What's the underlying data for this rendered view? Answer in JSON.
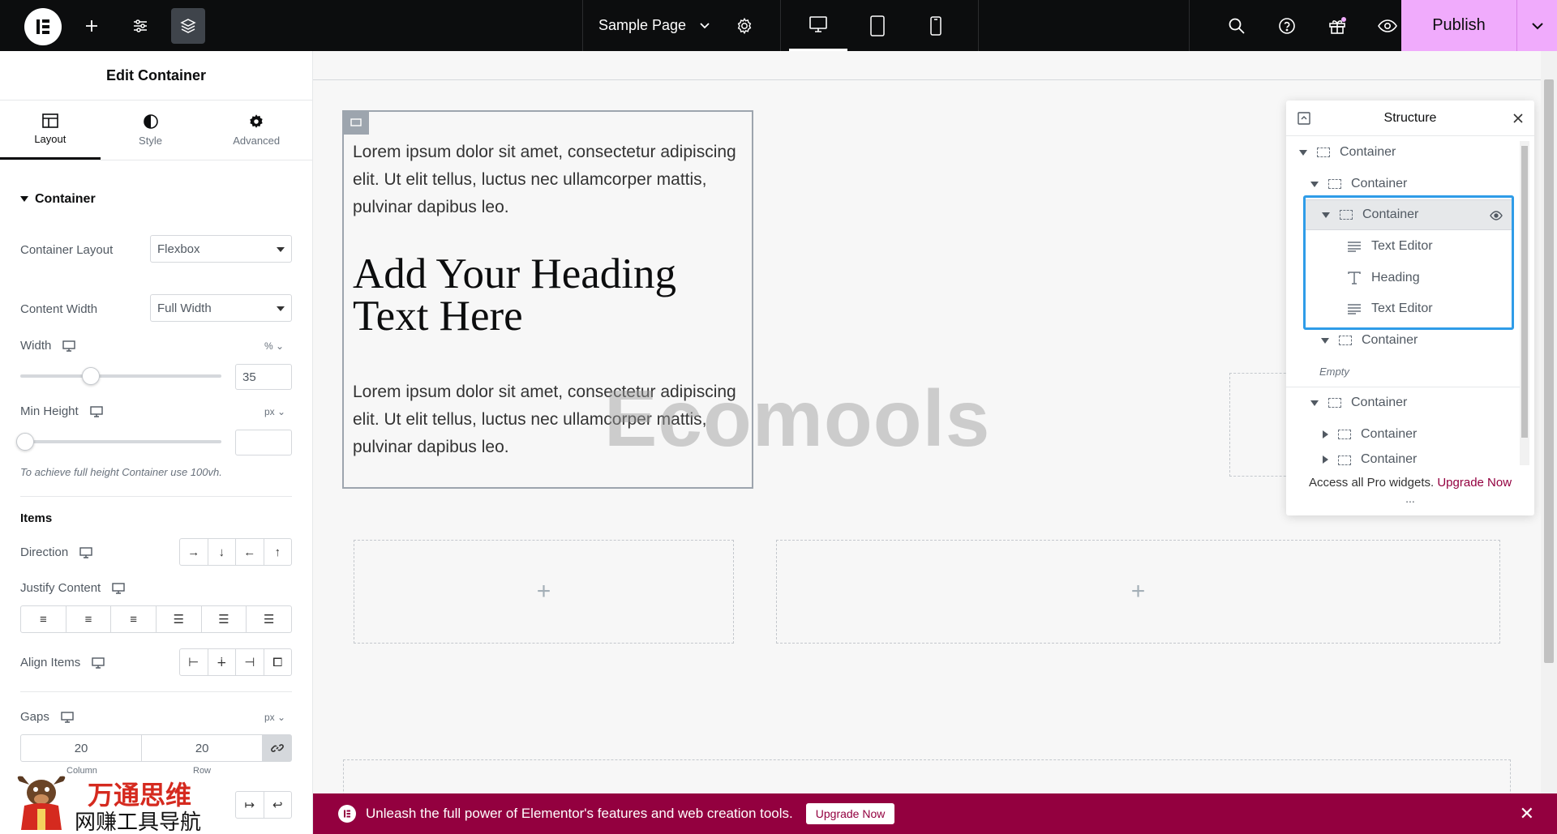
{
  "topbar": {
    "page_title": "Sample Page",
    "publish_label": "Publish"
  },
  "panel": {
    "title": "Edit Container",
    "tabs": [
      {
        "label": "Layout",
        "icon": "layout-icon"
      },
      {
        "label": "Style",
        "icon": "half-circle-icon"
      },
      {
        "label": "Advanced",
        "icon": "gear-icon"
      }
    ],
    "section": "Container",
    "container_layout": {
      "label": "Container Layout",
      "value": "Flexbox"
    },
    "content_width": {
      "label": "Content Width",
      "value": "Full Width"
    },
    "width": {
      "label": "Width",
      "unit": "%",
      "value": "35",
      "slider_percent": 35
    },
    "min_height": {
      "label": "Min Height",
      "unit": "px",
      "value": "",
      "slider_percent": 0
    },
    "note": "To achieve full height Container use 100vh.",
    "items_heading": "Items",
    "direction_label": "Direction",
    "justify_label": "Justify Content",
    "align_label": "Align Items",
    "gaps": {
      "label": "Gaps",
      "unit": "px",
      "column": "20",
      "row": "20",
      "column_caption": "Column",
      "row_caption": "Row"
    }
  },
  "canvas": {
    "paragraph_1": "Lorem ipsum dolor sit amet, consectetur adipiscing elit. Ut elit tellus, luctus nec ullamcorper mattis, pulvinar dapibus leo.",
    "heading": "Add Your Heading Text Here",
    "paragraph_2": "Lorem ipsum dolor sit amet, consectetur adipiscing elit. Ut elit tellus, luctus nec ullamcorper mattis, pulvinar dapibus leo.",
    "watermark": "Ecomools",
    "add_symbol": "+"
  },
  "structure": {
    "title": "Structure",
    "rows": [
      {
        "label": "Container",
        "type": "container",
        "caret": "down"
      },
      {
        "label": "Container",
        "type": "container",
        "caret": "down"
      },
      {
        "label": "Container",
        "type": "container",
        "caret": "down",
        "selected": true
      },
      {
        "label": "Text Editor",
        "type": "text-editor"
      },
      {
        "label": "Heading",
        "type": "heading"
      },
      {
        "label": "Text Editor",
        "type": "text-editor"
      },
      {
        "label": "Container",
        "type": "container",
        "caret": "down"
      },
      {
        "label": "Empty",
        "type": "empty"
      },
      {
        "label": "Container",
        "type": "container",
        "caret": "down"
      },
      {
        "label": "Container",
        "type": "container",
        "caret": "right"
      },
      {
        "label": "Container",
        "type": "container",
        "caret": "right"
      }
    ],
    "footer_text": "Access all Pro widgets.",
    "footer_link": "Upgrade Now",
    "more": "..."
  },
  "promo": {
    "text": "Unleash the full power of Elementor's features and web creation tools.",
    "button": "Upgrade Now"
  },
  "brand": {
    "line1": "万通思维",
    "line2": "网赚工具导航"
  },
  "colors": {
    "publish_bg": "#f0abfc",
    "promo_bg": "#93003f",
    "highlight": "#2f9ce8",
    "topbar_bg": "#0c0d0e"
  }
}
